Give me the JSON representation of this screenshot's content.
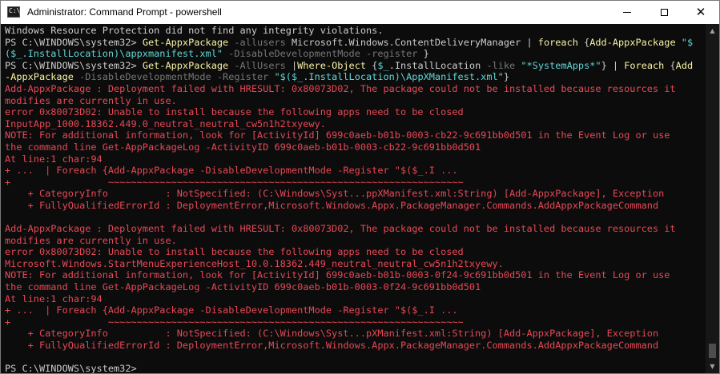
{
  "window": {
    "title": "Administrator: Command Prompt - powershell",
    "icon": "cmd-icon",
    "icon_text": "C:\\"
  },
  "controls": {
    "minimize": "minimize-icon",
    "maximize": "maximize-icon",
    "close_glyph": "✕"
  },
  "colors": {
    "normal": "#cccccc",
    "error": "#e74856",
    "command": "#f9f1a5",
    "param": "#767676",
    "string": "#61d6d6",
    "console_bg": "#0c0c0c"
  },
  "scrollbar": {
    "up_glyph": "▲",
    "down_glyph": "▼"
  },
  "console": {
    "lines": [
      [
        [
          "normal",
          "Windows Resource Protection did not find any integrity violations."
        ]
      ],
      [
        [
          "normal",
          "PS C:\\WINDOWS\\system32> "
        ],
        [
          "command",
          "Get-AppxPackage"
        ],
        [
          "param",
          " -allusers "
        ],
        [
          "normal",
          "Microsoft.Windows.ContentDeliveryManager | "
        ],
        [
          "command",
          "foreach"
        ],
        [
          "normal",
          " {"
        ],
        [
          "command",
          "Add-AppxPackage"
        ],
        [
          "string",
          " \"$"
        ]
      ],
      [
        [
          "string",
          "($_.InstallLocation)\\appxmanifest.xml\""
        ],
        [
          "param",
          " -DisableDevelopmentMode -register "
        ],
        [
          "normal",
          "}"
        ]
      ],
      [
        [
          "normal",
          "PS C:\\WINDOWS\\system32> "
        ],
        [
          "command",
          "Get-AppxPackage"
        ],
        [
          "param",
          " -AllUsers "
        ],
        [
          "normal",
          "|"
        ],
        [
          "command",
          "Where-Object"
        ],
        [
          "normal",
          " {"
        ],
        [
          "string",
          "$_"
        ],
        [
          "normal",
          ".InstallLocation "
        ],
        [
          "param",
          "-like"
        ],
        [
          "string",
          " \"*SystemApps*\""
        ],
        [
          "normal",
          "} | "
        ],
        [
          "command",
          "Foreach"
        ],
        [
          "normal",
          " {"
        ],
        [
          "command",
          "Add"
        ]
      ],
      [
        [
          "command",
          "-AppxPackage"
        ],
        [
          "param",
          " -DisableDevelopmentMode -Register "
        ],
        [
          "string",
          "\"$($_.InstallLocation)\\AppXManifest.xml\""
        ],
        [
          "normal",
          "}"
        ]
      ],
      [
        [
          "error",
          "Add-AppxPackage : Deployment failed with HRESULT: 0x80073D02, The package could not be installed because resources it"
        ]
      ],
      [
        [
          "error",
          "modifies are currently in use."
        ]
      ],
      [
        [
          "error",
          "error 0x80073D02: Unable to install because the following apps need to be closed"
        ]
      ],
      [
        [
          "error",
          "InputApp_1000.18362.449.0_neutral_neutral_cw5n1h2txyewy."
        ]
      ],
      [
        [
          "error",
          "NOTE: For additional information, look for [ActivityId] 699c0aeb-b01b-0003-cb22-9c691bb0d501 in the Event Log or use"
        ]
      ],
      [
        [
          "error",
          "the command line Get-AppPackageLog -ActivityID 699c0aeb-b01b-0003-cb22-9c691bb0d501"
        ]
      ],
      [
        [
          "error",
          "At line:1 char:94"
        ]
      ],
      [
        [
          "error",
          "+ ...  | Foreach {Add-AppxPackage -DisableDevelopmentMode -Register \"$($_.I ..."
        ]
      ],
      [
        [
          "error",
          "+                 ~~~~~~~~~~~~~~~~~~~~~~~~~~~~~~~~~~~~~~~~~~~~~~~~~~~~~~~~~~~~~~"
        ]
      ],
      [
        [
          "error",
          "    + CategoryInfo          : NotSpecified: (C:\\Windows\\Syst...ppXManifest.xml:String) [Add-AppxPackage], Exception"
        ]
      ],
      [
        [
          "error",
          "    + FullyQualifiedErrorId : DeploymentError,Microsoft.Windows.Appx.PackageManager.Commands.AddAppxPackageCommand"
        ]
      ],
      [
        [
          "normal",
          ""
        ]
      ],
      [
        [
          "error",
          "Add-AppxPackage : Deployment failed with HRESULT: 0x80073D02, The package could not be installed because resources it"
        ]
      ],
      [
        [
          "error",
          "modifies are currently in use."
        ]
      ],
      [
        [
          "error",
          "error 0x80073D02: Unable to install because the following apps need to be closed"
        ]
      ],
      [
        [
          "error",
          "Microsoft.Windows.StartMenuExperienceHost_10.0.18362.449_neutral_neutral_cw5n1h2txyewy."
        ]
      ],
      [
        [
          "error",
          "NOTE: For additional information, look for [ActivityId] 699c0aeb-b01b-0003-0f24-9c691bb0d501 in the Event Log or use"
        ]
      ],
      [
        [
          "error",
          "the command line Get-AppPackageLog -ActivityID 699c0aeb-b01b-0003-0f24-9c691bb0d501"
        ]
      ],
      [
        [
          "error",
          "At line:1 char:94"
        ]
      ],
      [
        [
          "error",
          "+ ...  | Foreach {Add-AppxPackage -DisableDevelopmentMode -Register \"$($_.I ..."
        ]
      ],
      [
        [
          "error",
          "+                 ~~~~~~~~~~~~~~~~~~~~~~~~~~~~~~~~~~~~~~~~~~~~~~~~~~~~~~~~~~~~~~"
        ]
      ],
      [
        [
          "error",
          "    + CategoryInfo          : NotSpecified: (C:\\Windows\\Syst...pXManifest.xml:String) [Add-AppxPackage], Exception"
        ]
      ],
      [
        [
          "error",
          "    + FullyQualifiedErrorId : DeploymentError,Microsoft.Windows.Appx.PackageManager.Commands.AddAppxPackageCommand"
        ]
      ],
      [
        [
          "normal",
          ""
        ]
      ],
      [
        [
          "normal",
          "PS C:\\WINDOWS\\system32>"
        ]
      ]
    ]
  }
}
